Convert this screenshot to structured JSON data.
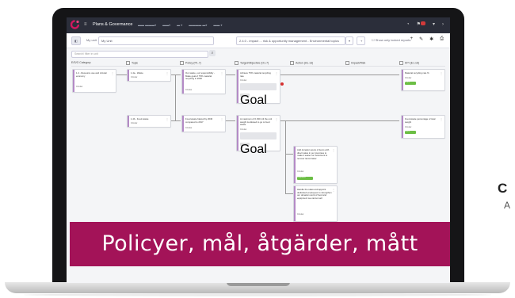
{
  "app": {
    "title": "Plans & Governance",
    "nav": [
      "▾",
      "▾",
      "▾",
      "▾",
      "▾"
    ],
    "brand_color": "#a31358"
  },
  "filters": {
    "my_unit_label": "My unit",
    "unit_value": "My Unit",
    "goal_dropdown": "2.4.0 - impact ... risk & opportunity management - Environmental topics",
    "only_locked_label": "Show only locked reports"
  },
  "search": {
    "placeholder": "Search/ filter in unit"
  },
  "columns": [
    {
      "label": "E/S/G Category"
    },
    {
      "label": "Topic"
    },
    {
      "label": "Policy (P1.7)"
    },
    {
      "label": "Target/Objective (O1.7)"
    },
    {
      "label": "Action (A1.13)"
    },
    {
      "label": "Impact/Risk"
    },
    {
      "label": "KPI (E1.16)"
    }
  ],
  "cards": {
    "esg": {
      "text": "1.4 - Resource use and circular economy",
      "meta": "Circular"
    },
    "topic1": {
      "text": "1.4a - Waste",
      "meta": "Circular"
    },
    "topic2": {
      "text": "1.4b - Food waste",
      "meta": "Circular"
    },
    "policy1": {
      "text": "Our waste, our responsibility - Make goal of 75% material recycling in 2030",
      "meta": "Circular"
    },
    "policy2": {
      "text": "Food waste halved by 2030 compared to 2017",
      "meta": "Circular"
    },
    "target1": {
      "text": "Achieve 75% material recycling rate",
      "meta": "Circular",
      "pill": "Goal"
    },
    "target2": {
      "text": "A maximum of 0.030 m3 the unit weight is allowed to go to food waste",
      "meta": "Circular",
      "pill": "Goal"
    },
    "action1": {
      "text": "Add donation spots of items with direct sales in our premises to make it easier for customers to recover items faster",
      "meta": "Circular",
      "badge": "Completed"
    },
    "action2": {
      "text": "Handle the sales and appoint dedicated employees to strengthen our donation work of food and equipment we cannot sell",
      "meta": "Circular"
    },
    "kpi1": {
      "text": "Material recycling rate %",
      "meta": "Circular",
      "badge": "82.4%"
    },
    "kpi2": {
      "text": "Food waste percentage of total weight",
      "meta": "Circular",
      "badge": "0.03%"
    }
  },
  "banner": {
    "text": "Policyer, mål, åtgärder, mått"
  },
  "side": {
    "letter1": "C",
    "letter2": "A"
  }
}
